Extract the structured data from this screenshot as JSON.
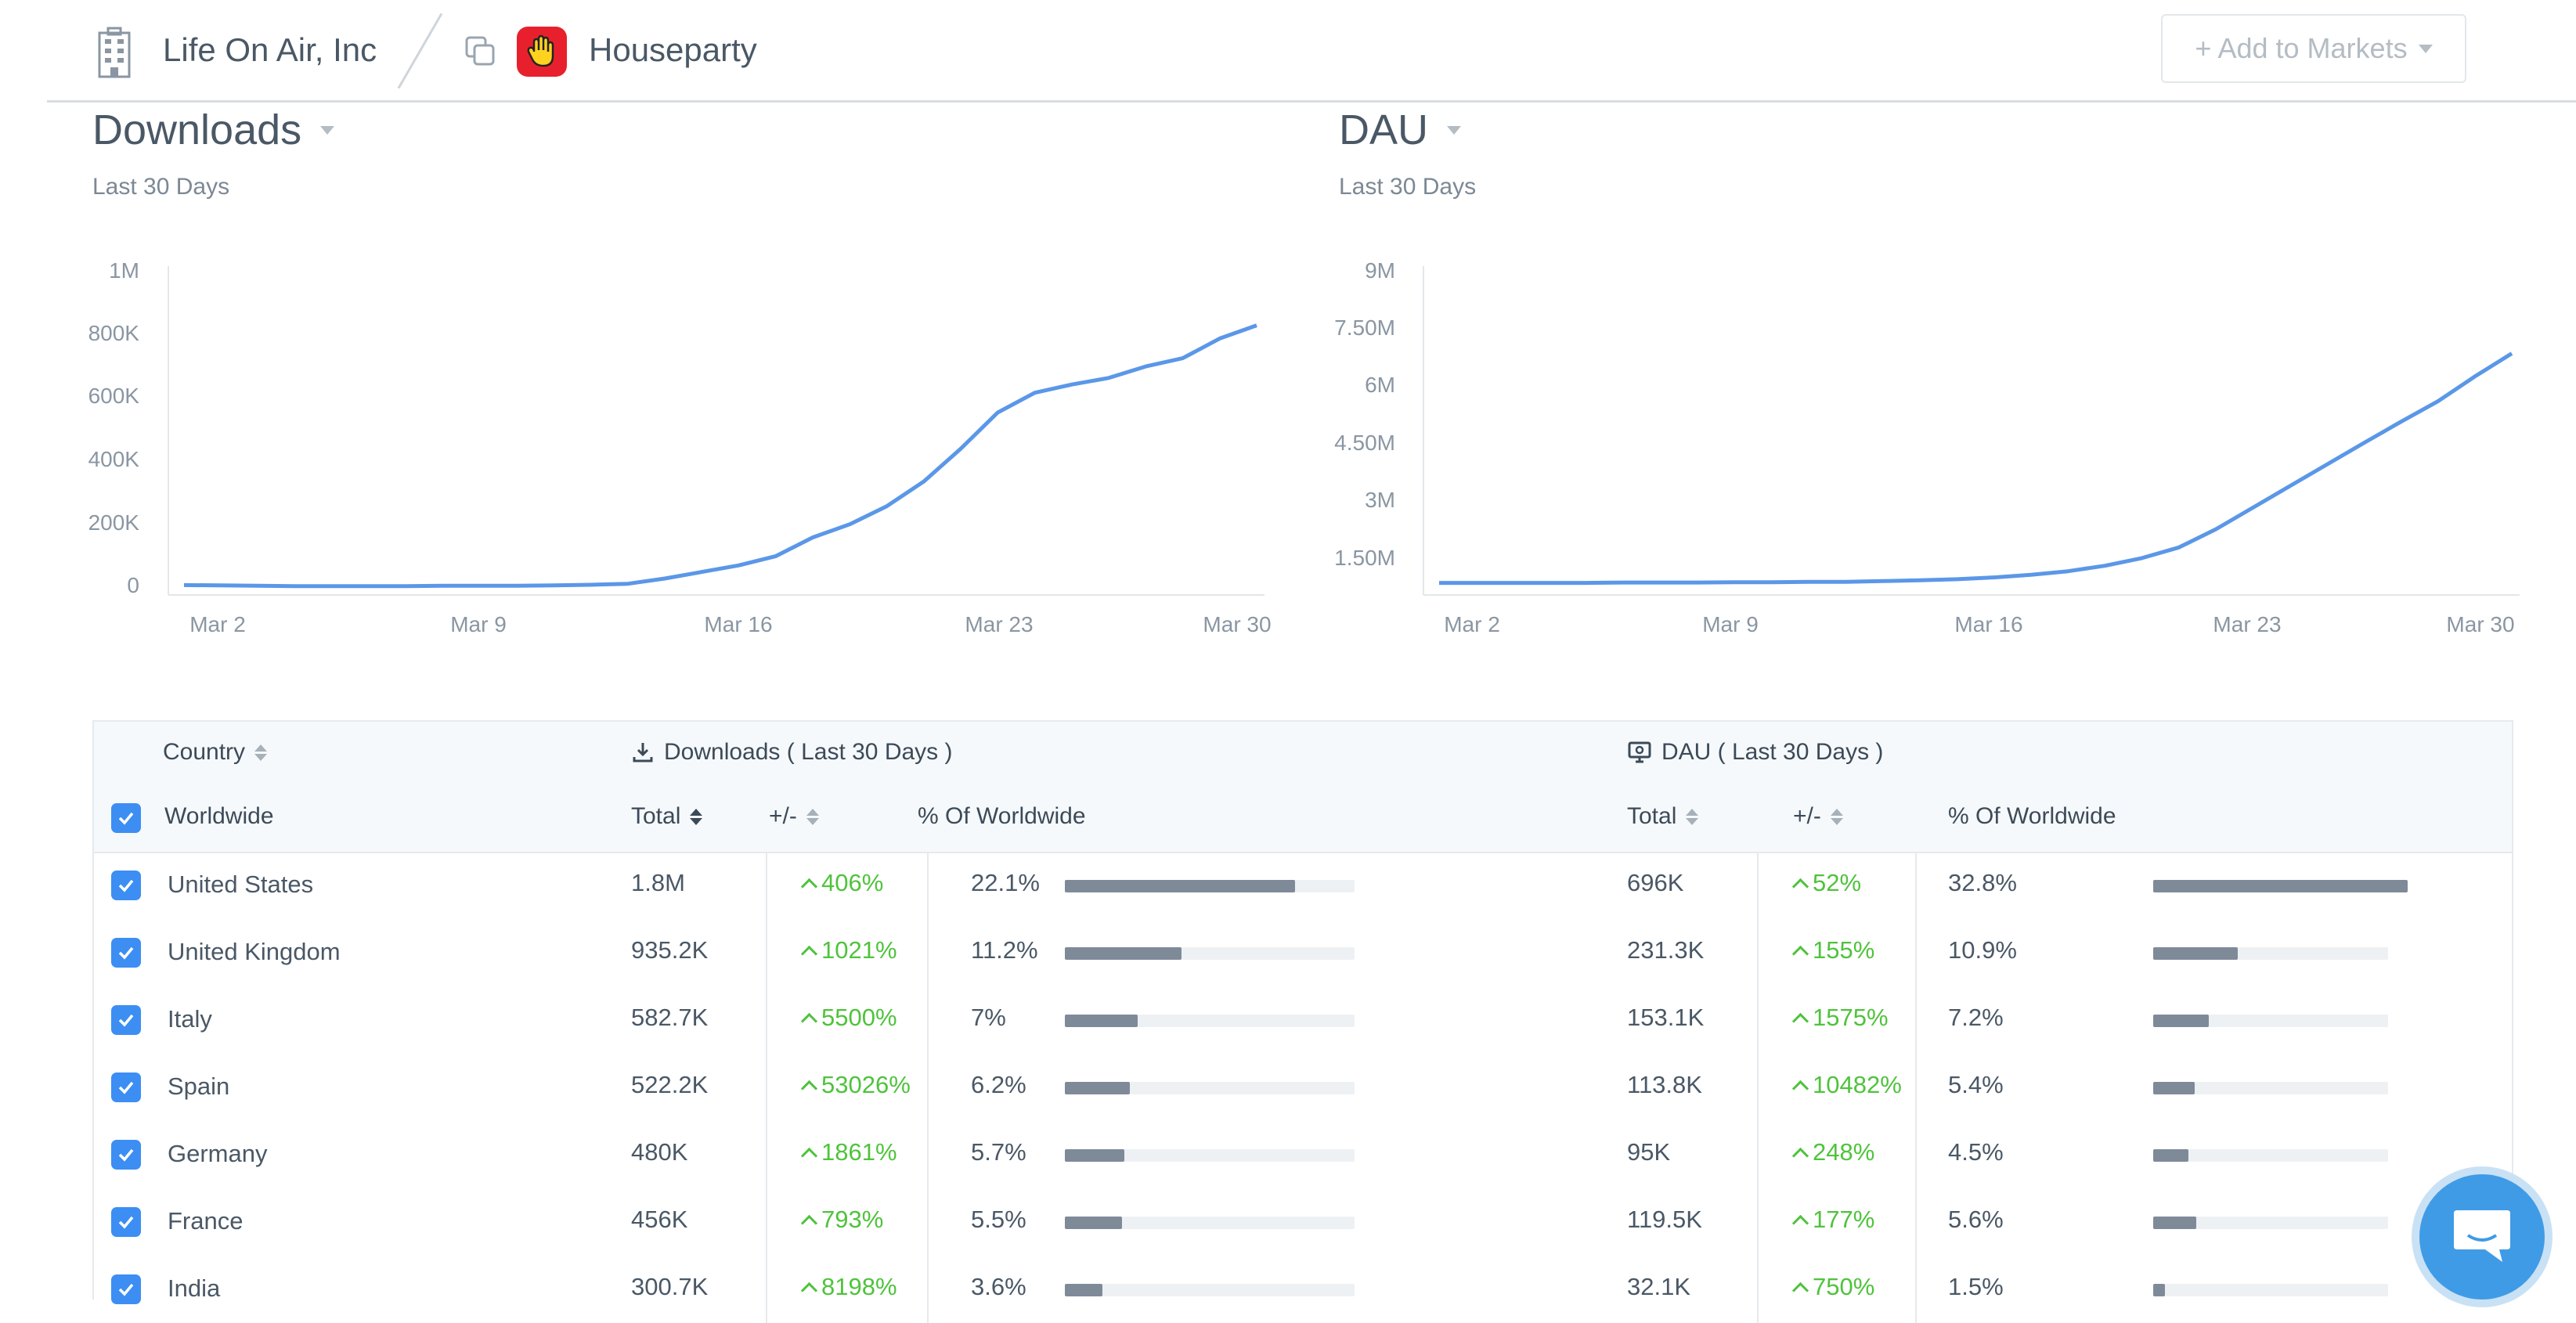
{
  "header": {
    "company": "Life On Air, Inc",
    "app": "Houseparty",
    "add_to_markets": "+ Add to Markets"
  },
  "downloads_chart": {
    "title": "Downloads",
    "subtitle": "Last 30 Days",
    "y_ticks": [
      "1M",
      "800K",
      "600K",
      "400K",
      "200K",
      "0"
    ],
    "x_ticks": [
      "Mar 2",
      "Mar 9",
      "Mar 16",
      "Mar 23",
      "Mar 30"
    ]
  },
  "dau_chart": {
    "title": "DAU",
    "subtitle": "Last 30 Days",
    "y_ticks": [
      "9M",
      "7.50M",
      "6M",
      "4.50M",
      "3M",
      "1.50M"
    ],
    "x_ticks": [
      "Mar 2",
      "Mar 9",
      "Mar 16",
      "Mar 23",
      "Mar 30"
    ]
  },
  "chart_data": [
    {
      "type": "line",
      "title": "Downloads",
      "ylim": [
        0,
        1000000
      ],
      "x": [
        "Mar 1",
        "Mar 2",
        "Mar 3",
        "Mar 4",
        "Mar 5",
        "Mar 6",
        "Mar 7",
        "Mar 8",
        "Mar 9",
        "Mar 10",
        "Mar 11",
        "Mar 12",
        "Mar 13",
        "Mar 14",
        "Mar 15",
        "Mar 16",
        "Mar 17",
        "Mar 18",
        "Mar 19",
        "Mar 20",
        "Mar 21",
        "Mar 22",
        "Mar 23",
        "Mar 24",
        "Mar 25",
        "Mar 26",
        "Mar 27",
        "Mar 28",
        "Mar 29",
        "Mar 30"
      ],
      "series": [
        {
          "values": [
            30000,
            29000,
            28000,
            27000,
            27000,
            27000,
            27000,
            28000,
            28000,
            28000,
            29000,
            31000,
            34000,
            50000,
            70000,
            90000,
            118000,
            175000,
            215000,
            270000,
            345000,
            445000,
            555000,
            615000,
            640000,
            660000,
            695000,
            720000,
            780000,
            820000
          ]
        }
      ]
    },
    {
      "type": "line",
      "title": "DAU",
      "ylim": [
        0,
        9000000
      ],
      "x": [
        "Mar 1",
        "Mar 2",
        "Mar 3",
        "Mar 4",
        "Mar 5",
        "Mar 6",
        "Mar 7",
        "Mar 8",
        "Mar 9",
        "Mar 10",
        "Mar 11",
        "Mar 12",
        "Mar 13",
        "Mar 14",
        "Mar 15",
        "Mar 16",
        "Mar 17",
        "Mar 18",
        "Mar 19",
        "Mar 20",
        "Mar 21",
        "Mar 22",
        "Mar 23",
        "Mar 24",
        "Mar 25",
        "Mar 26",
        "Mar 27",
        "Mar 28",
        "Mar 29",
        "Mar 30"
      ],
      "series": [
        {
          "values": [
            330000,
            330000,
            330000,
            330000,
            330000,
            340000,
            340000,
            340000,
            350000,
            350000,
            360000,
            360000,
            380000,
            400000,
            430000,
            480000,
            550000,
            650000,
            800000,
            1010000,
            1300000,
            1800000,
            2390000,
            2980000,
            3570000,
            4160000,
            4740000,
            5300000,
            5980000,
            6610000
          ]
        }
      ]
    }
  ],
  "table": {
    "group_country": "Country",
    "group_downloads": "Downloads ( Last 30 Days )",
    "group_dau": "DAU ( Last 30 Days )",
    "worldwide": "Worldwide",
    "col_total": "Total",
    "col_change": "+/-",
    "col_pct": "% Of Worldwide",
    "rows": [
      {
        "country": "United States",
        "dl_total": "1.8M",
        "dl_change": "406%",
        "dl_pct": "22.1%",
        "dl_share": 0.221,
        "dau_total": "696K",
        "dau_change": "52%",
        "dau_pct": "32.8%",
        "dau_share": 0.328
      },
      {
        "country": "United Kingdom",
        "dl_total": "935.2K",
        "dl_change": "1021%",
        "dl_pct": "11.2%",
        "dl_share": 0.112,
        "dau_total": "231.3K",
        "dau_change": "155%",
        "dau_pct": "10.9%",
        "dau_share": 0.109
      },
      {
        "country": "Italy",
        "dl_total": "582.7K",
        "dl_change": "5500%",
        "dl_pct": "7%",
        "dl_share": 0.07,
        "dau_total": "153.1K",
        "dau_change": "1575%",
        "dau_pct": "7.2%",
        "dau_share": 0.072
      },
      {
        "country": "Spain",
        "dl_total": "522.2K",
        "dl_change": "53026%",
        "dl_pct": "6.2%",
        "dl_share": 0.062,
        "dau_total": "113.8K",
        "dau_change": "10482%",
        "dau_pct": "5.4%",
        "dau_share": 0.054
      },
      {
        "country": "Germany",
        "dl_total": "480K",
        "dl_change": "1861%",
        "dl_pct": "5.7%",
        "dl_share": 0.057,
        "dau_total": "95K",
        "dau_change": "248%",
        "dau_pct": "4.5%",
        "dau_share": 0.045
      },
      {
        "country": "France",
        "dl_total": "456K",
        "dl_change": "793%",
        "dl_pct": "5.5%",
        "dl_share": 0.055,
        "dau_total": "119.5K",
        "dau_change": "177%",
        "dau_pct": "5.6%",
        "dau_share": 0.056
      },
      {
        "country": "India",
        "dl_total": "300.7K",
        "dl_change": "8198%",
        "dl_pct": "3.6%",
        "dl_share": 0.036,
        "dau_total": "32.1K",
        "dau_change": "750%",
        "dau_pct": "1.5%",
        "dau_share": 0.015
      }
    ]
  },
  "colors": {
    "line": "#5b97e8",
    "positive": "#4fc33c",
    "checkbox": "#3c8ef3",
    "bar": "#7f8a99"
  },
  "icons": {
    "company": "building-icon",
    "app_switch": "copy-icon",
    "app": "waving-hand-icon",
    "download": "download-icon",
    "dau": "monitor-icon",
    "chat": "chat-icon"
  }
}
